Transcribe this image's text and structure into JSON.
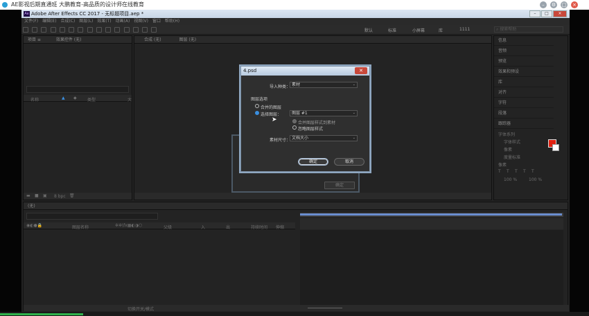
{
  "player": {
    "title": "AE影视后期直通班 大鹏教育-高品质的设计师在线教育",
    "icons": [
      "minimize-icon",
      "settings-icon",
      "fullscreen-icon",
      "close-icon"
    ]
  },
  "ae": {
    "title": "Adobe After Effects CC 2017 - 无标题项目.aep *",
    "menu": [
      "文件(F)",
      "编辑(E)",
      "合成(C)",
      "图层(L)",
      "效果(T)",
      "动画(A)",
      "视图(V)",
      "窗口",
      "帮助(H)"
    ],
    "workspaces": [
      "默认",
      "标准",
      "小屏幕",
      "库",
      "1111"
    ],
    "search_placeholder": "搜索帮助",
    "project_tab": "项目 ≡",
    "effects_tab": "效果控件 (无)",
    "comp_tab": "合成 (无)",
    "layer_tab": "图层 (无)",
    "project_cols": [
      "名称",
      "类型",
      "大"
    ],
    "project_footer": "8 bpc",
    "right_panels": [
      "信息",
      "音频",
      "预览",
      "效果和预设",
      "库",
      "对齐",
      "字符",
      "段落",
      "跟踪器"
    ],
    "char_labels": [
      "字体系列",
      "字体样式",
      "像素",
      "度量标准",
      "像素",
      "100 %",
      "100 %"
    ],
    "timeline_tab": "(无)",
    "timeline_cols": [
      "图层名称",
      "父级",
      "入",
      "出",
      "持续时间",
      "伸缩"
    ],
    "timeline_footer": "切换开关/模式"
  },
  "back_dialog": {
    "ok_label": "确定"
  },
  "dialog": {
    "title": "4.psd",
    "import_kind_label": "导入种类：",
    "import_kind_value": "素材",
    "layer_options_label": "图层选项",
    "merged_label": "合并的图层",
    "choose_layer_label": "选择图层：",
    "choose_layer_value": "图层 #1",
    "merge_styles_label": "合并图层样式到素材",
    "ignore_styles_label": "忽略图层样式",
    "footage_size_label": "素材尺寸：",
    "footage_size_value": "文档大小",
    "ok_label": "确定",
    "cancel_label": "取消"
  }
}
